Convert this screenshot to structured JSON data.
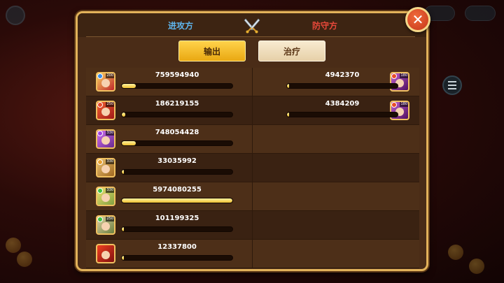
{
  "header": {
    "attack_label": "进攻方",
    "defense_label": "防守方"
  },
  "tabs": [
    {
      "label": "输出",
      "active": true
    },
    {
      "label": "治疗",
      "active": false
    }
  ],
  "attackers": [
    {
      "value": "759594940",
      "fill": 0.127,
      "hero": "hero-portrait-1",
      "level": "200",
      "gem_color": "#3a8ee8"
    },
    {
      "value": "186219155",
      "fill": 0.031,
      "hero": "hero-portrait-2",
      "level": "250",
      "gem_color": "#e84a2a"
    },
    {
      "value": "748054428",
      "fill": 0.125,
      "hero": "hero-portrait-3",
      "level": "330",
      "gem_color": "#a040e0"
    },
    {
      "value": "33035992",
      "fill": 0.006,
      "hero": "hero-portrait-4",
      "level": "330",
      "gem_color": "#e8a030"
    },
    {
      "value": "5974080255",
      "fill": 1.0,
      "hero": "hero-portrait-5",
      "level": "330",
      "gem_color": "#40c040"
    },
    {
      "value": "101199325",
      "fill": 0.017,
      "hero": "hero-portrait-6",
      "level": "250",
      "gem_color": "#40c040"
    },
    {
      "value": "12337800",
      "fill": 0.002,
      "hero": "hero-portrait-7",
      "level": "",
      "gem_color": ""
    }
  ],
  "defenders": [
    {
      "value": "4942370",
      "fill": 0.001,
      "hero": "enemy-portrait-1",
      "level": "180",
      "gem_color": "#e84a2a"
    },
    {
      "value": "4384209",
      "fill": 0.001,
      "hero": "enemy-portrait-2",
      "level": "180",
      "gem_color": "#e84a2a"
    }
  ],
  "colors": {
    "attack": "#5fb6ee",
    "defense": "#e8483a",
    "panel_border": "#e2b25a",
    "bar_fill": "#f0c030"
  },
  "icons": {
    "crossed_swords": "crossed-swords-icon",
    "close": "close-icon",
    "menu": "list-menu-icon"
  }
}
